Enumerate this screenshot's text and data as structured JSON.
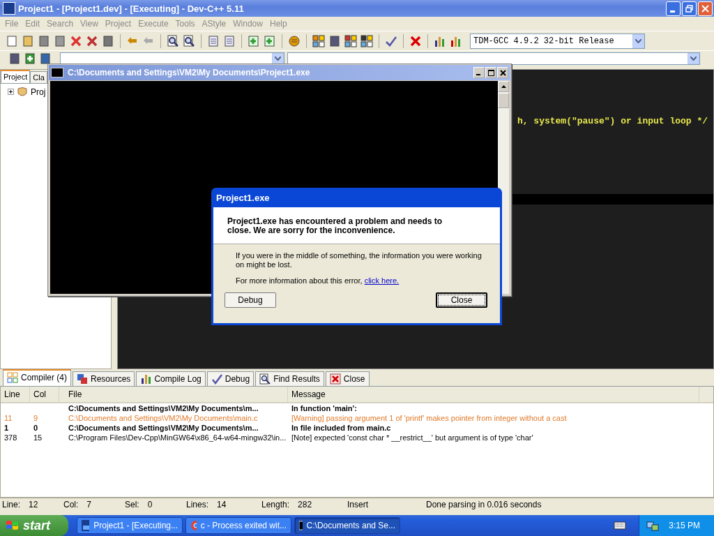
{
  "window": {
    "title": "Project1 - [Project1.dev] - [Executing] - Dev-C++ 5.11"
  },
  "menu": [
    "File",
    "Edit",
    "Search",
    "View",
    "Project",
    "Execute",
    "Tools",
    "AStyle",
    "Window",
    "Help"
  ],
  "toolbar": {
    "compiler_select": "TDM-GCC 4.9.2 32-bit Release"
  },
  "left_panel": {
    "tabs": [
      {
        "label": "Project",
        "selected": true
      },
      {
        "label": "Cla",
        "selected": false
      }
    ],
    "tree": [
      {
        "label": "Proj",
        "expanded": false
      }
    ]
  },
  "editor": {
    "code_line": "h, system(\"pause\") or input loop */"
  },
  "console_window": {
    "title": "C:\\Documents and Settings\\VM2\\My Documents\\Project1.exe"
  },
  "error_dialog": {
    "title": "Project1.exe",
    "headline": "Project1.exe has encountered a problem and needs to close.  We are sorry for the inconvenience.",
    "body": "If you were in the middle of something, the information you were working on might be lost.",
    "more_info": "For more information about this error,",
    "link": "click here.",
    "buttons": [
      "Debug",
      "Close"
    ]
  },
  "bottom_tabs": [
    {
      "label": "Compiler (4)",
      "selected": true
    },
    {
      "label": "Resources",
      "selected": false
    },
    {
      "label": "Compile Log",
      "selected": false
    },
    {
      "label": "Debug",
      "selected": false
    },
    {
      "label": "Find Results",
      "selected": false
    },
    {
      "label": "Close",
      "selected": false
    }
  ],
  "table": {
    "columns": [
      "Line",
      "Col",
      "File",
      "Message"
    ],
    "rows": [
      {
        "kind": "context",
        "file": "C:\\Documents and Settings\\VM2\\My Documents\\m...",
        "message": "In function 'main':"
      },
      {
        "kind": "warning",
        "line": "11",
        "col": "9",
        "file": "C:\\Documents and Settings\\VM2\\My Documents\\main.c",
        "message": "[Warning] passing argument 1 of 'printf' makes pointer from integer without a cast"
      },
      {
        "kind": "context",
        "line": "1",
        "col": "0",
        "file": "C:\\Documents and Settings\\VM2\\My Documents\\m...",
        "message": "In file included from main.c"
      },
      {
        "kind": "note",
        "line": "378",
        "col": "15",
        "file": "C:\\Program Files\\Dev-Cpp\\MinGW64\\x86_64-w64-mingw32\\in...",
        "message": "[Note] expected 'const char * __restrict__' but argument is of type 'char'"
      }
    ]
  },
  "status_bar": [
    {
      "label": "Line:",
      "value": "12"
    },
    {
      "label": "Col:",
      "value": "7"
    },
    {
      "label": "Sel:",
      "value": "0"
    },
    {
      "label": "Lines:",
      "value": "14"
    },
    {
      "label": "Length:",
      "value": "282"
    },
    {
      "value": "Insert"
    },
    {
      "value": "Done parsing in 0.016 seconds"
    }
  ],
  "taskbar": {
    "start": "start",
    "buttons": [
      {
        "label": "Project1 - [Executing...",
        "selected": false
      },
      {
        "label": "c - Process exited wit...",
        "selected": false
      },
      {
        "label": "C:\\Documents and Se...",
        "selected": true
      }
    ],
    "clock": "3:15 PM"
  }
}
